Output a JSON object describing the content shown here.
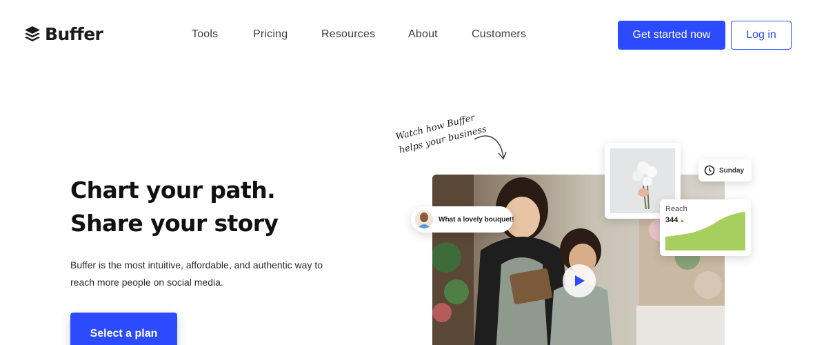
{
  "header": {
    "logo_text": "Buffer",
    "nav": [
      "Tools",
      "Pricing",
      "Resources",
      "About",
      "Customers"
    ],
    "get_started_label": "Get started now",
    "login_label": "Log in"
  },
  "hero": {
    "title_line1": "Chart your path.",
    "title_line2": "Share your story",
    "description": "Buffer is the most intuitive, affordable, and authentic way to reach more people on social media.",
    "cta_label": "Select a plan"
  },
  "video_section": {
    "note_line1": "Watch how Buffer",
    "note_line2": "helps your business",
    "comment": "What a lovely bouquet!",
    "day": "Sunday",
    "reach_label": "Reach",
    "reach_value": "344",
    "reach_trend_icon": "triangle-up-icon",
    "play_icon": "play-icon"
  },
  "colors": {
    "brand_blue": "#2c4bff",
    "reach_green": "#a6cf5f",
    "text_dark": "#111111"
  }
}
